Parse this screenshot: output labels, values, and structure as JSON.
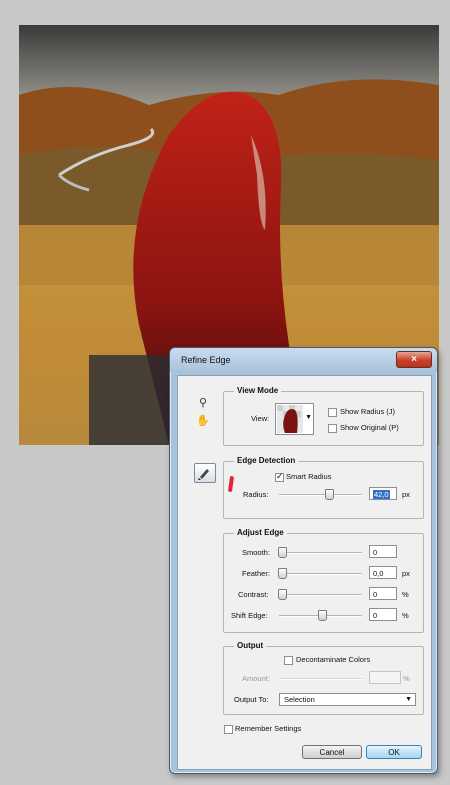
{
  "photo": {
    "description_icon": "photo"
  },
  "dialog": {
    "title": "Refine Edge",
    "close_label": "×",
    "view_mode": {
      "legend": "View Mode",
      "view_label": "View:",
      "show_radius": "Show Radius (J)",
      "show_original": "Show Original (P)",
      "show_radius_checked": false,
      "show_original_checked": false
    },
    "edge_detection": {
      "legend": "Edge Detection",
      "smart_radius": "Smart Radius",
      "smart_radius_checked": true,
      "radius_label": "Radius:",
      "radius_value": "42,0",
      "radius_unit": "px",
      "radius_fraction": 0.42
    },
    "adjust_edge": {
      "legend": "Adjust Edge",
      "smooth_label": "Smooth:",
      "smooth_value": "0",
      "feather_label": "Feather:",
      "feather_value": "0,0",
      "feather_unit": "px",
      "contrast_label": "Contrast:",
      "contrast_value": "0",
      "contrast_unit": "%",
      "shift_edge_label": "Shift Edge:",
      "shift_edge_value": "0",
      "shift_edge_unit": "%"
    },
    "output": {
      "legend": "Output",
      "decontaminate": "Decontaminate Colors",
      "decontaminate_checked": false,
      "amount_label": "Amount:",
      "amount_unit": "%",
      "output_to_label": "Output To:",
      "output_to_value": "Selection"
    },
    "remember_settings": "Remember Settings",
    "remember_checked": false,
    "cancel": "Cancel",
    "ok": "OK"
  },
  "colors": {
    "accent": "#3c7fb1",
    "close": "#c8412b",
    "hair": "#8b1410"
  }
}
